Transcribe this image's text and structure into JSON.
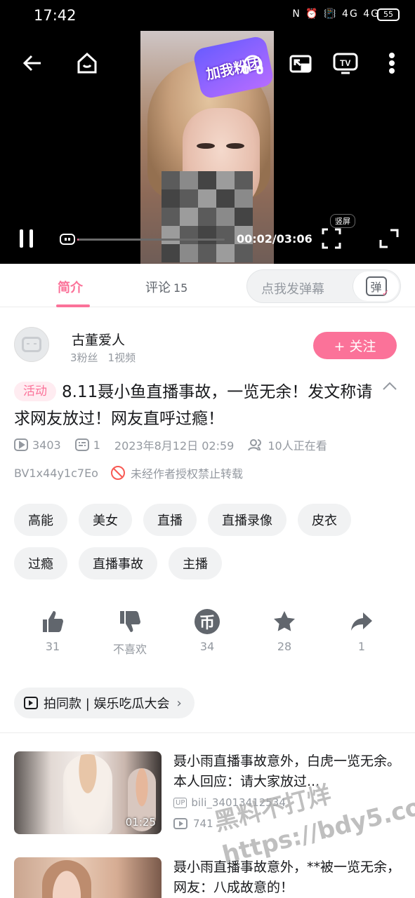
{
  "status_bar": {
    "time": "17:42",
    "icons": "N ⏰ 📳 4G 4G",
    "battery": "55"
  },
  "player": {
    "sticker_text": "加我粉团",
    "current_time": "00:02",
    "total_time": "03:06",
    "time_display": "00:02/03:06",
    "progress": 0.011,
    "portrait_badge": "竖屏"
  },
  "tabs": [
    {
      "label": "简介",
      "active": true
    },
    {
      "label": "评论",
      "count": "15",
      "active": false
    }
  ],
  "danmaku": {
    "placeholder": "点我发弹幕",
    "button": "弹"
  },
  "uploader": {
    "name": "古董爱人",
    "fans": "3粉丝",
    "videos": "1视频",
    "follow_label": "+ 关注"
  },
  "video": {
    "activity_tag": "活动",
    "title": "8.11聂小鱼直播事故，一览无余！发文称请求网友放过！网友直呼过瘾！",
    "views": "3403",
    "danmaku_count": "1",
    "publish_time": "2023年8月12日 02:59",
    "watching": "10人正在看",
    "bvid": "BV1x44y1c7Eo",
    "copyright": "未经作者授权禁止转载"
  },
  "tags": [
    "高能",
    "美女",
    "直播",
    "直播录像",
    "皮衣",
    "过瘾",
    "直播事故",
    "主播"
  ],
  "actions": {
    "like": "31",
    "dislike": "不喜欢",
    "coin": "34",
    "favorite": "28",
    "share": "1"
  },
  "collection": {
    "label": "拍同款 | 娱乐吃瓜大会"
  },
  "recommendations": [
    {
      "title": "聂小雨直播事故意外，白虎一览无余。本人回应：请大家放过...",
      "duration": "01:25",
      "up_name": "bili_34013412534",
      "views": "741"
    },
    {
      "title": "聂小雨直播事故意外，**被一览无余，网友：八成故意的！",
      "duration": "",
      "up_name": "",
      "views": ""
    }
  ],
  "watermark": {
    "line1": "黑料不打烊",
    "line2": "https://bdy5.co"
  }
}
